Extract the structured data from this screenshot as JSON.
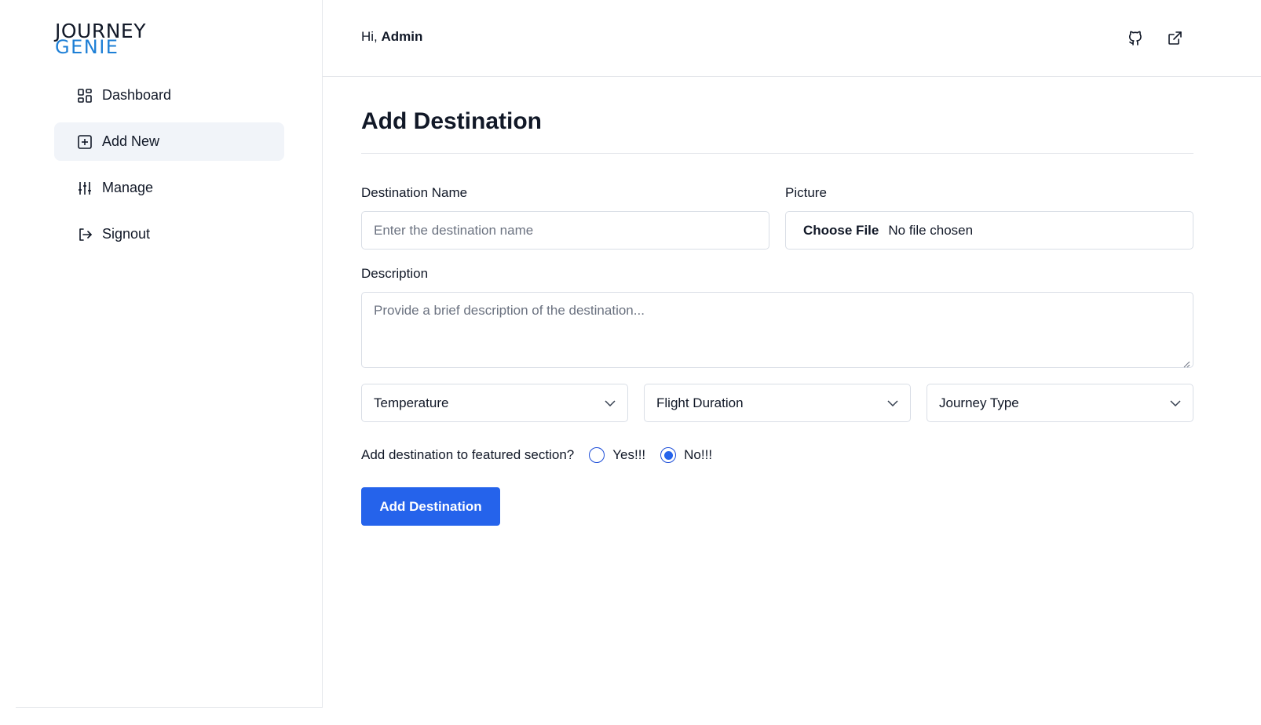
{
  "brand": {
    "line1": "JOURNEY",
    "line2": "GENIE"
  },
  "sidebar": {
    "items": [
      {
        "label": "Dashboard",
        "icon": "dashboard-grid-icon"
      },
      {
        "label": "Add New",
        "icon": "plus-square-icon",
        "active": true
      },
      {
        "label": "Manage",
        "icon": "sliders-icon"
      },
      {
        "label": "Signout",
        "icon": "logout-icon"
      }
    ]
  },
  "header": {
    "greeting": "Hi,",
    "user": "Admin",
    "icons": [
      "github-icon",
      "external-link-icon"
    ]
  },
  "main": {
    "title": "Add Destination",
    "fields": {
      "name_label": "Destination Name",
      "name_placeholder": "Enter the destination name",
      "picture_label": "Picture",
      "file_button": "Choose File",
      "file_status": "No file chosen",
      "description_label": "Description",
      "description_placeholder": "Provide a brief description of the destination..."
    },
    "selects": [
      {
        "value": "Temperature"
      },
      {
        "value": "Flight Duration"
      },
      {
        "value": "Journey Type"
      }
    ],
    "featured": {
      "question": "Add destination to featured section?",
      "options": [
        "Yes!!!",
        "No!!!"
      ],
      "selected": "No!!!"
    },
    "submit_label": "Add Destination"
  },
  "colors": {
    "accent": "#2563eb",
    "brand_blue": "#1d7fd6",
    "active_bg": "#f1f4f9",
    "border": "#d9dee6"
  }
}
